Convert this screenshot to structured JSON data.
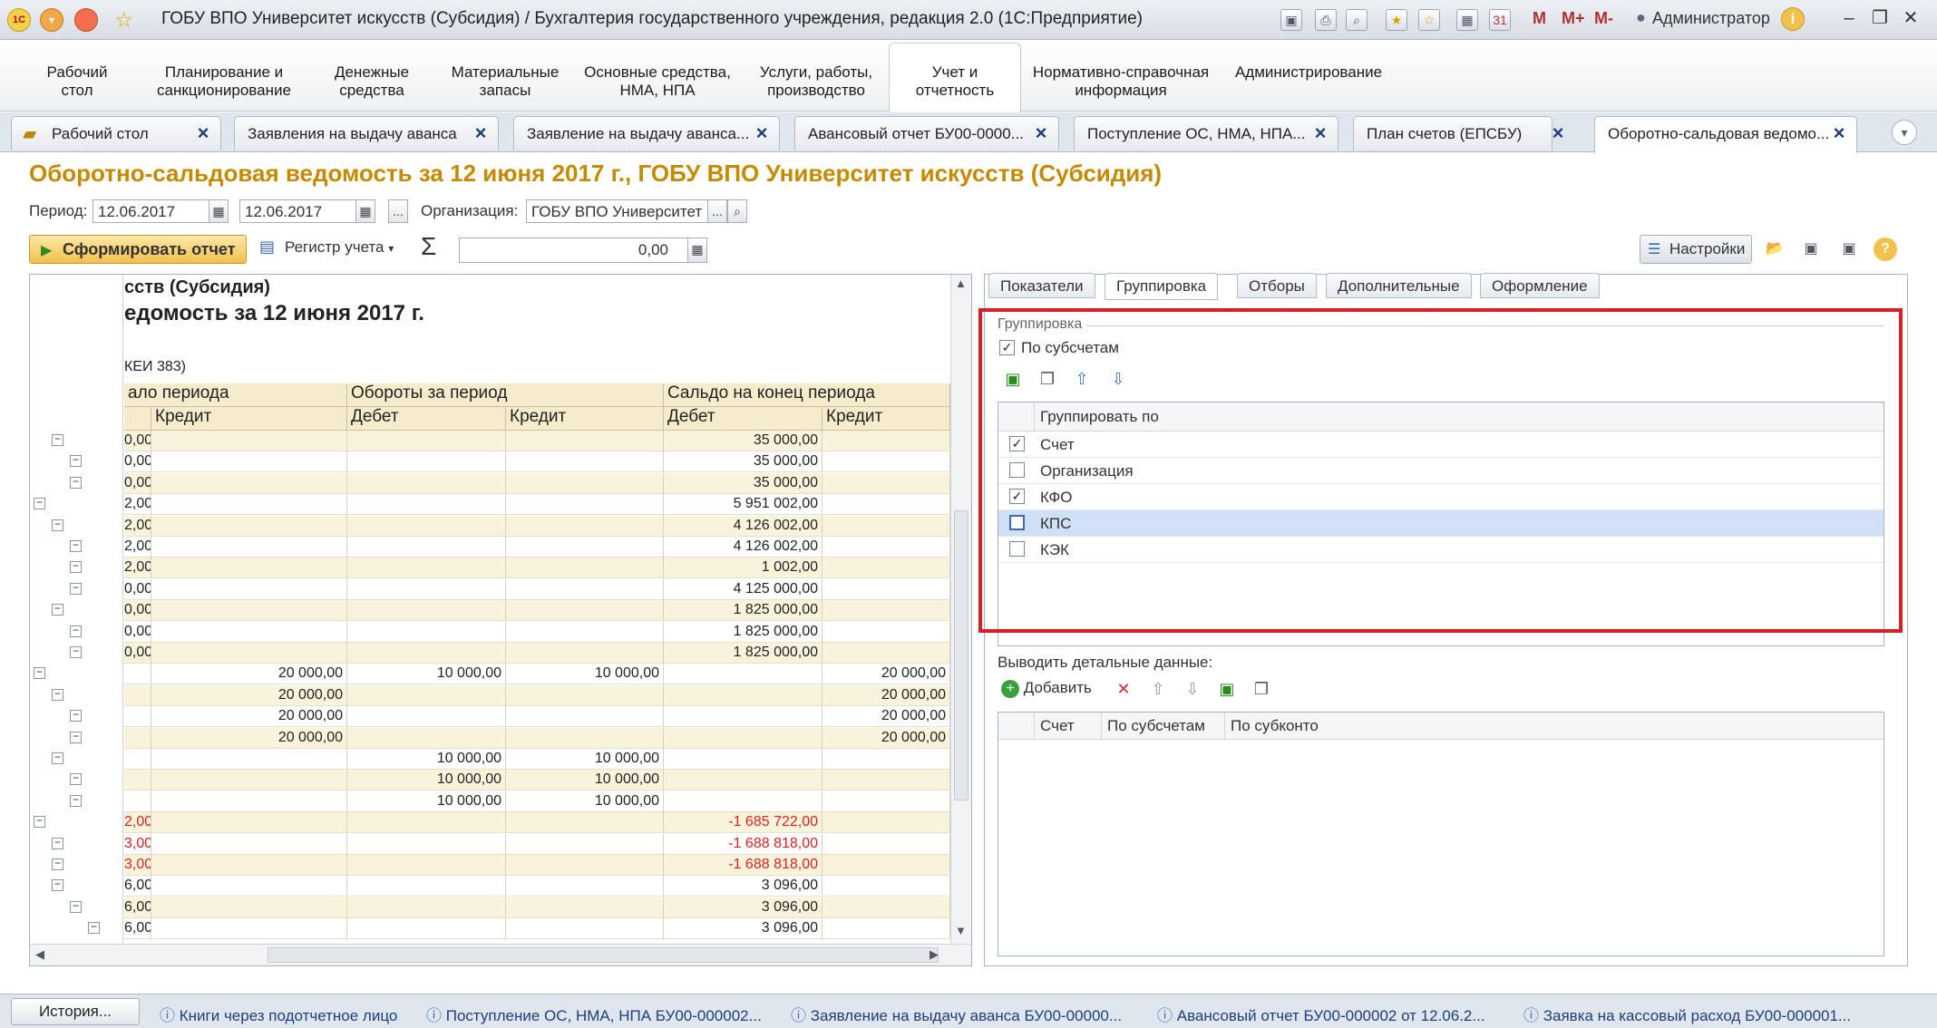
{
  "titlebar": {
    "title": "ГОБУ ВПО Университет искусств (Субсидия) / Бухгалтерия государственного учреждения, редакция 2.0  (1С:Предприятие)",
    "m_buttons": [
      "M",
      "M+",
      "M-"
    ],
    "user": "Администратор"
  },
  "sections": [
    {
      "label": "Рабочий\nстол"
    },
    {
      "label": "Планирование и\nсанкционирование"
    },
    {
      "label": "Денежные\nсредства"
    },
    {
      "label": "Материальные\nзапасы"
    },
    {
      "label": "Основные средства,\nНМА, НПА"
    },
    {
      "label": "Услуги, работы,\nпроизводство"
    },
    {
      "label": "Учет и\nотчетность"
    },
    {
      "label": "Нормативно-справочная\nинформация"
    },
    {
      "label": "Администрирование"
    }
  ],
  "window_tabs": [
    {
      "label": "Рабочий стол"
    },
    {
      "label": "Заявления на выдачу аванса"
    },
    {
      "label": "Заявление на выдачу аванса..."
    },
    {
      "label": "Авансовый отчет БУ00-0000..."
    },
    {
      "label": "Поступление ОС, НМА, НПА..."
    },
    {
      "label": "План счетов (ЕПСБУ)"
    },
    {
      "label": "Оборотно-сальдовая ведомо..."
    }
  ],
  "form": {
    "title": "Оборотно-сальдовая ведомость за 12 июня 2017 г., ГОБУ ВПО Университет искусств (Субсидия)",
    "period_label": "Период:",
    "period_from": "12.06.2017",
    "period_to": "12.06.2017",
    "ellipsis": "...",
    "org_label": "Организация:",
    "org_value": "ГОБУ ВПО Университет",
    "generate_label": "Сформировать отчет",
    "register_label": "Регистр учета",
    "sum_value": "0,00",
    "settings_label": "Настройки"
  },
  "report": {
    "header_line1": "сств (Субсидия)",
    "header_line2": "едомость за 12 июня 2017 г.",
    "header_line3": "КЕИ 383)",
    "col_group1": "ало периода",
    "col_group2": "Обороты за период",
    "col_group3": "Сальдо на конец периода",
    "col_credit": "Кредит",
    "col_debit": "Дебет",
    "rows": [
      {
        "c0": "0,00",
        "c1": "",
        "c2": "",
        "c3": "",
        "c4": "35 000,00",
        "c5": "",
        "neg": false
      },
      {
        "c0": "0,00",
        "c1": "",
        "c2": "",
        "c3": "",
        "c4": "35 000,00",
        "c5": "",
        "neg": false
      },
      {
        "c0": "0,00",
        "c1": "",
        "c2": "",
        "c3": "",
        "c4": "35 000,00",
        "c5": "",
        "neg": false
      },
      {
        "c0": "2,00",
        "c1": "",
        "c2": "",
        "c3": "",
        "c4": "5 951 002,00",
        "c5": "",
        "neg": false
      },
      {
        "c0": "2,00",
        "c1": "",
        "c2": "",
        "c3": "",
        "c4": "4 126 002,00",
        "c5": "",
        "neg": false
      },
      {
        "c0": "2,00",
        "c1": "",
        "c2": "",
        "c3": "",
        "c4": "4 126 002,00",
        "c5": "",
        "neg": false
      },
      {
        "c0": "2,00",
        "c1": "",
        "c2": "",
        "c3": "",
        "c4": "1 002,00",
        "c5": "",
        "neg": false
      },
      {
        "c0": "0,00",
        "c1": "",
        "c2": "",
        "c3": "",
        "c4": "4 125 000,00",
        "c5": "",
        "neg": false
      },
      {
        "c0": "0,00",
        "c1": "",
        "c2": "",
        "c3": "",
        "c4": "1 825 000,00",
        "c5": "",
        "neg": false
      },
      {
        "c0": "0,00",
        "c1": "",
        "c2": "",
        "c3": "",
        "c4": "1 825 000,00",
        "c5": "",
        "neg": false
      },
      {
        "c0": "0,00",
        "c1": "",
        "c2": "",
        "c3": "",
        "c4": "1 825 000,00",
        "c5": "",
        "neg": false
      },
      {
        "c0": "",
        "c1": "20 000,00",
        "c2": "10 000,00",
        "c3": "10 000,00",
        "c4": "",
        "c5": "20 000,00",
        "neg": false
      },
      {
        "c0": "",
        "c1": "20 000,00",
        "c2": "",
        "c3": "",
        "c4": "",
        "c5": "20 000,00",
        "neg": false
      },
      {
        "c0": "",
        "c1": "20 000,00",
        "c2": "",
        "c3": "",
        "c4": "",
        "c5": "20 000,00",
        "neg": false
      },
      {
        "c0": "",
        "c1": "20 000,00",
        "c2": "",
        "c3": "",
        "c4": "",
        "c5": "20 000,00",
        "neg": false
      },
      {
        "c0": "",
        "c1": "",
        "c2": "10 000,00",
        "c3": "10 000,00",
        "c4": "",
        "c5": "",
        "neg": false
      },
      {
        "c0": "",
        "c1": "",
        "c2": "10 000,00",
        "c3": "10 000,00",
        "c4": "",
        "c5": "",
        "neg": false
      },
      {
        "c0": "",
        "c1": "",
        "c2": "10 000,00",
        "c3": "10 000,00",
        "c4": "",
        "c5": "",
        "neg": false
      },
      {
        "c0": "2,00",
        "c1": "",
        "c2": "",
        "c3": "",
        "c4": "-1 685 722,00",
        "c5": "",
        "neg": true
      },
      {
        "c0": "3,00",
        "c1": "",
        "c2": "",
        "c3": "",
        "c4": "-1 688 818,00",
        "c5": "",
        "neg": true
      },
      {
        "c0": "3,00",
        "c1": "",
        "c2": "",
        "c3": "",
        "c4": "-1 688 818,00",
        "c5": "",
        "neg": true
      },
      {
        "c0": "6,00",
        "c1": "",
        "c2": "",
        "c3": "",
        "c4": "3 096,00",
        "c5": "",
        "neg": false
      },
      {
        "c0": "6,00",
        "c1": "",
        "c2": "",
        "c3": "",
        "c4": "3 096,00",
        "c5": "",
        "neg": false
      },
      {
        "c0": "6,00",
        "c1": "",
        "c2": "",
        "c3": "",
        "c4": "3 096,00",
        "c5": "",
        "neg": false
      }
    ]
  },
  "settings": {
    "tabs": [
      "Показатели",
      "Группировка",
      "Отборы",
      "Дополнительные",
      "Оформление"
    ],
    "active_tab": "Группировка",
    "group_legend": "Группировка",
    "by_subaccounts_label": "По субсчетам",
    "by_subaccounts_checked": true,
    "group_by_header": "Группировать по",
    "group_items": [
      {
        "label": "Счет",
        "checked": true,
        "selected": false
      },
      {
        "label": "Организация",
        "checked": false,
        "selected": false
      },
      {
        "label": "КФО",
        "checked": true,
        "selected": false
      },
      {
        "label": "КПС",
        "checked": false,
        "selected": true
      },
      {
        "label": "КЭК",
        "checked": false,
        "selected": false
      }
    ],
    "detail_label": "Выводить детальные данные:",
    "add_label": "Добавить",
    "detail_headers": [
      "Счет",
      "По субсчетам",
      "По субконто"
    ]
  },
  "history": {
    "button_label": "История...",
    "items": [
      "Книги через подотчетное лицо",
      "Поступление ОС, НМА, НПА БУ00-000002...",
      "Заявление на выдачу аванса БУ00-00000...",
      "Авансовый отчет БУ00-000002 от 12.06.2...",
      "Заявка на кассовый расход БУ00-000001..."
    ]
  },
  "colors": {
    "accent_title": "#c48a00",
    "highlight_frame": "#d91f26",
    "negative_value": "#e02020",
    "selected_row": "#cfe0f7"
  }
}
